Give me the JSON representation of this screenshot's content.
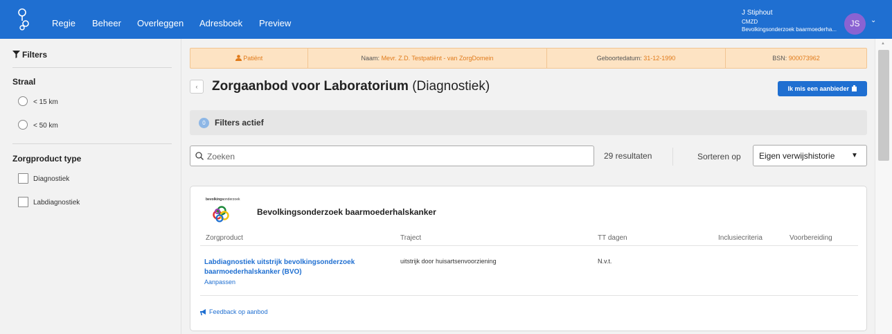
{
  "topbar": {
    "logo_icon": "user-network-icon",
    "nav": [
      "Regie",
      "Beheer",
      "Overleggen",
      "Adresboek",
      "Preview"
    ],
    "user": {
      "name": "J Stiphout",
      "org": "CMZD",
      "project": "Bevolkingsonderzoek baarmoederha...",
      "initials": "JS"
    }
  },
  "sidebar": {
    "title": "Filters",
    "radius": {
      "title": "Straal",
      "options": [
        "< 15 km",
        "< 50 km"
      ]
    },
    "product_type": {
      "title": "Zorgproduct type",
      "options": [
        "Diagnostiek",
        "Labdiagnostiek"
      ]
    }
  },
  "patient": {
    "label": "Patiënt",
    "name_label": "Naam:",
    "name": "Mevr. Z.D. Testpatiënt - van ZorgDomein",
    "dob_label": "Geboortedatum:",
    "dob": "31-12-1990",
    "bsn_label": "BSN:",
    "bsn": "900073962"
  },
  "page": {
    "back_label": "‹",
    "title_bold": "Zorgaanbod voor Laboratorium",
    "title_rest": " (Diagnostiek)",
    "missing_button": "Ik mis een aanbieder"
  },
  "filters_bar": {
    "count": "0",
    "label": "Filters actief"
  },
  "search": {
    "placeholder": "Zoeken",
    "results": "29 resultaten",
    "sort_label": "Sorteren op",
    "sort_value": "Eigen verwijshistorie"
  },
  "card": {
    "logo_text_bold": "bevolkings",
    "logo_text_rest": "onderzoek",
    "provider": "Bevolkingsonderzoek baarmoederhalskanker",
    "columns": [
      "Zorgproduct",
      "Traject",
      "TT dagen",
      "Inclusiecriteria",
      "Voorbereiding"
    ],
    "row": {
      "product": "Labdiagnostiek uitstrijk bevolkingsonderzoek baarmoederhalskanker (BVO)",
      "edit": "Aanpassen",
      "traject": "uitstrijk door huisartsenvoorziening",
      "tt_days": "N.v.t."
    },
    "feedback": "Feedback op aanbod"
  },
  "colors": {
    "primary": "#1f6fd1",
    "patient_bg": "#fde3c3",
    "patient_value": "#e07a1a",
    "avatar": "#8a63d2"
  }
}
